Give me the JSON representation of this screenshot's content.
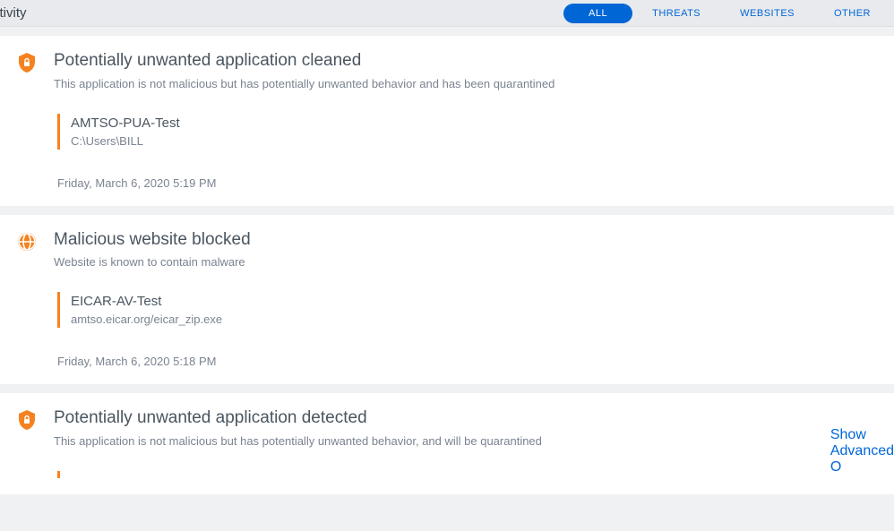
{
  "header": {
    "title": "ctivity",
    "tabs": {
      "all": "ALL",
      "threats": "THREATS",
      "websites": "WEBSITES",
      "other": "OTHER"
    }
  },
  "activities": [
    {
      "icon": "shield-lock",
      "title": "Potentially unwanted application cleaned",
      "subtitle": "This application is not malicious but has potentially unwanted behavior and has been quarantined",
      "detail_name": "AMTSO-PUA-Test",
      "detail_path": "C:\\Users\\BILL",
      "timestamp": "Friday, March 6, 2020 5:19 PM"
    },
    {
      "icon": "globe",
      "title": "Malicious website blocked",
      "subtitle": "Website is known to contain malware",
      "detail_name": "EICAR-AV-Test",
      "detail_path": "amtso.eicar.org/eicar_zip.exe",
      "timestamp": "Friday, March 6, 2020 5:18 PM"
    },
    {
      "icon": "shield-lock",
      "title": "Potentially unwanted application detected",
      "subtitle": "This application is not malicious but has potentially unwanted behavior, and will be quarantined",
      "action": "Show Advanced O"
    }
  ]
}
